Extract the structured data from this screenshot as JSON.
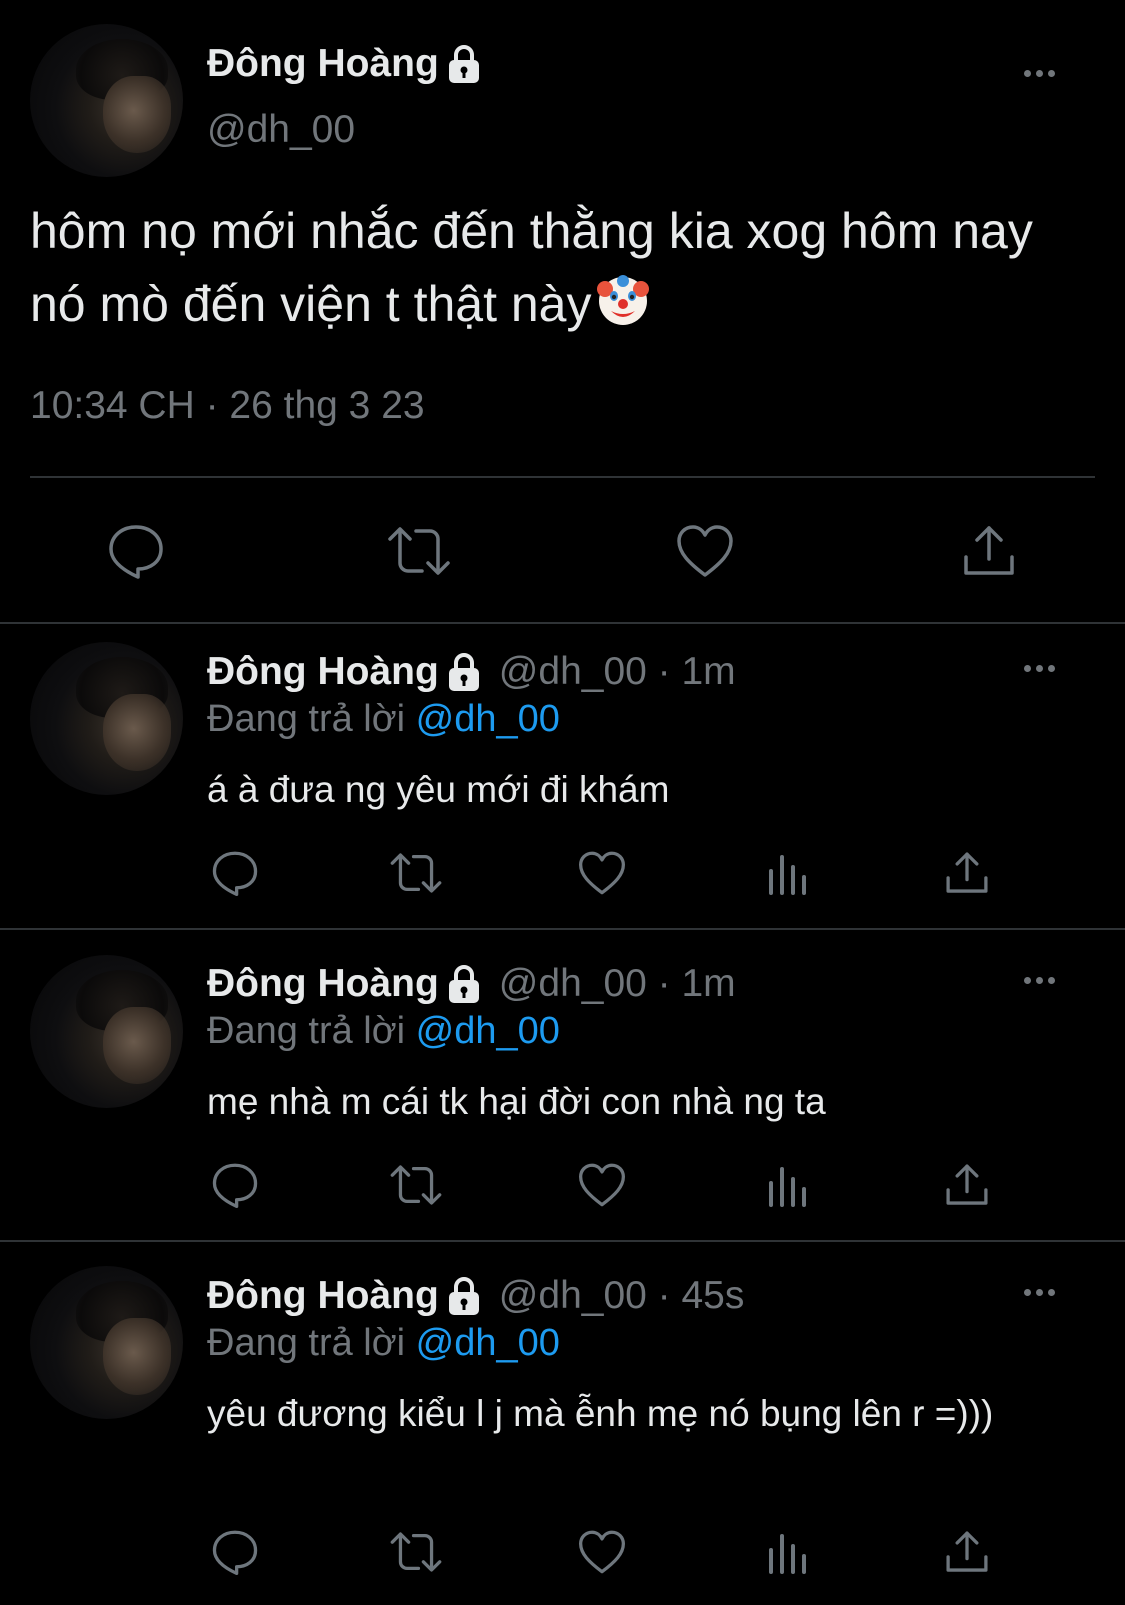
{
  "main_tweet": {
    "display_name": "Đông Hoàng",
    "handle": "@dh_00",
    "text": "hôm nọ mới nhắc đến thằng kia xog hôm nay nó mò đến viện t thật này",
    "emoji": "clown-face-icon",
    "timestamp": "10:34 CH · 26 thg 3 23",
    "actions": [
      "reply-icon",
      "retweet-icon",
      "like-icon",
      "share-icon"
    ]
  },
  "replies": [
    {
      "display_name": "Đông Hoàng",
      "handle_time": "@dh_00 · 1m",
      "replying_prefix": "Đang trả lời",
      "replying_to": "@dh_00",
      "text": "á à đưa ng yêu mới đi khám"
    },
    {
      "display_name": "Đông Hoàng",
      "handle_time": "@dh_00 · 1m",
      "replying_prefix": "Đang trả lời",
      "replying_to": "@dh_00",
      "text": "mẹ nhà m cái tk hại đời con nhà ng ta"
    },
    {
      "display_name": "Đông Hoàng",
      "handle_time": "@dh_00 · 45s",
      "replying_prefix": "Đang trả lời",
      "replying_to": "@dh_00",
      "text": "yêu đương kiểu l j mà ễnh mẹ nó bụng lên r =)))"
    }
  ],
  "colors": {
    "background": "#000000",
    "text": "#e7e9ea",
    "secondary": "#71767b",
    "link": "#1d9bf0",
    "divider": "#2f3336"
  }
}
